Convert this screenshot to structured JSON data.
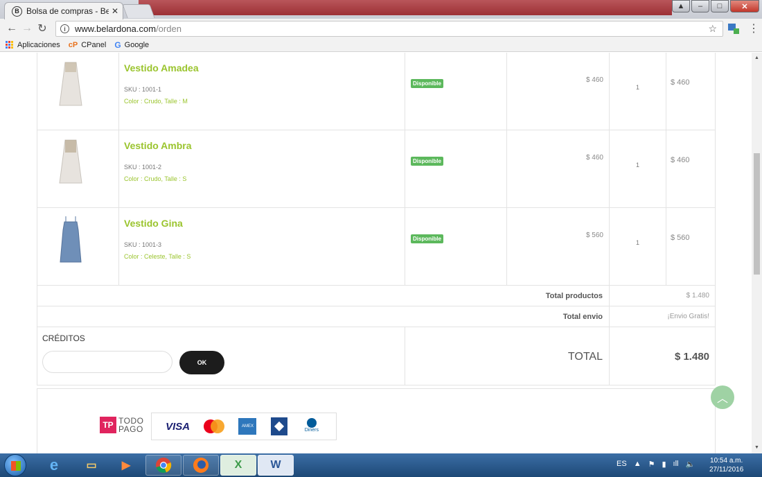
{
  "browser": {
    "tab_title": "Bolsa de compras - Belar",
    "favicon_letter": "B",
    "url_host": "www.belardona.com",
    "url_path": "/orden",
    "bookmarks": [
      {
        "label": "Aplicaciones",
        "icon": "apps-grid-icon"
      },
      {
        "label": "CPanel",
        "icon": "cpanel-icon"
      },
      {
        "label": "Google",
        "icon": "google-icon"
      }
    ]
  },
  "cart": {
    "items": [
      {
        "name": "Vestido Amadea",
        "sku": "SKU : 1001-1",
        "attributes": "Color : Crudo, Talle : M",
        "status": "Disponible",
        "price": "$ 460",
        "quantity": "1",
        "subtotal": "$ 460",
        "dress_color": "#e7e3de"
      },
      {
        "name": "Vestido Ambra",
        "sku": "SKU : 1001-2",
        "attributes": "Color : Crudo, Talle : S",
        "status": "Disponible",
        "price": "$ 460",
        "quantity": "1",
        "subtotal": "$ 460",
        "dress_color": "#e7e3de"
      },
      {
        "name": "Vestido Gina",
        "sku": "SKU : 1001-3",
        "attributes": "Color : Celeste, Talle : S",
        "status": "Disponible",
        "price": "$ 560",
        "quantity": "1",
        "subtotal": "$ 560",
        "dress_color": "#6f8fb8"
      }
    ],
    "total_products_label": "Total productos",
    "total_products_value": "$ 1.480",
    "total_shipping_label": "Total envio",
    "total_shipping_value": "¡Envio Gratis!",
    "credits_title": "CRÉDITOS",
    "credits_input_value": "",
    "ok_label": "OK",
    "total_label": "TOTAL",
    "total_value": "$ 1.480"
  },
  "payment": {
    "todopago_mark": "TP",
    "todopago_line1": "TODO",
    "todopago_line2": "PAGO",
    "visa": "VISA",
    "mastercard": "MasterCard",
    "amex": "AMERICAN EXPRESS",
    "cabal": "CABAL",
    "diners": "Diners Club International"
  },
  "taskbar": {
    "language": "ES",
    "time": "10:54 a.m.",
    "date": "27/11/2016",
    "apps": [
      "internet-explorer",
      "file-explorer",
      "media-player",
      "chrome",
      "firefox",
      "excel",
      "word"
    ]
  },
  "colors": {
    "accent_green": "#9ac42d",
    "badge_green": "#5cb85c",
    "button_dark": "#1c1c1c"
  }
}
